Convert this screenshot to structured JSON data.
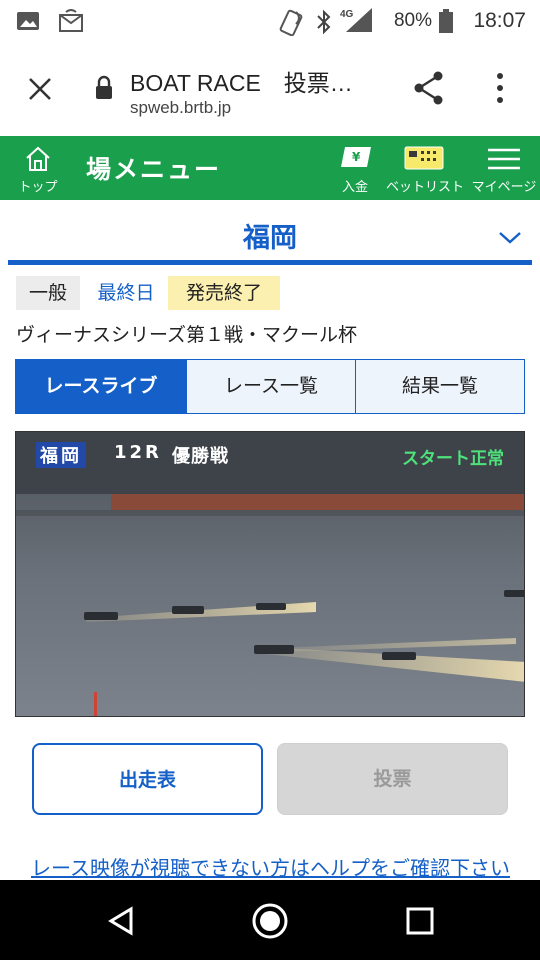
{
  "status_bar": {
    "battery": "80%",
    "time": "18:07",
    "icons": [
      "image-icon",
      "notification-icon",
      "nfc-icon",
      "bluetooth-icon",
      "signal-4g-icon",
      "battery-icon"
    ]
  },
  "browser": {
    "title": "BOAT RACE　投票…",
    "url": "spweb.brtb.jp"
  },
  "nav": {
    "top_label": "トップ",
    "menu_title": "場メニュー",
    "deposit_label": "入金",
    "betlist_label": "ベットリスト",
    "mypage_label": "マイページ"
  },
  "venue": {
    "name": "福岡"
  },
  "badges": {
    "grade": "一般",
    "day": "最終日",
    "sale_status": "発売終了"
  },
  "race_title": "ヴィーナスシリーズ第１戦・マクール杯",
  "tabs": [
    {
      "label": "レースライブ",
      "active": true
    },
    {
      "label": "レース一覧",
      "active": false
    },
    {
      "label": "結果一覧",
      "active": false
    }
  ],
  "video": {
    "overlay_venue": "福岡",
    "overlay_race": "12R",
    "overlay_event": "優勝戦",
    "overlay_status": "スタート正常"
  },
  "buttons": {
    "entry_table": "出走表",
    "vote": "投票"
  },
  "help_link": "レース映像が視聴できない方はヘルプをご確認下さい",
  "colors": {
    "brand_green": "#1aa04d",
    "accent_blue": "#1560c8",
    "badge_gray": "#ececec",
    "badge_yellow": "#fbf0b0"
  }
}
